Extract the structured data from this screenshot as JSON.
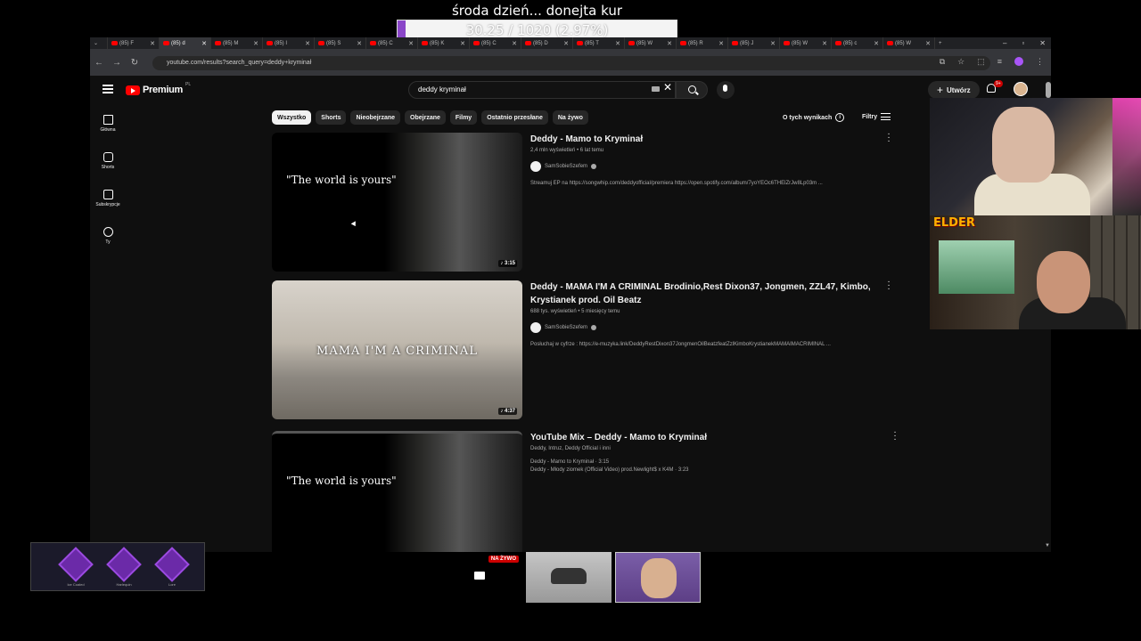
{
  "overlay": {
    "goal_title": "środa dzień... donejta kur",
    "goal_text": "30.25 / 1020 (2.97%)",
    "goal_progress": 0.0297,
    "goal_color": "#8a46c8"
  },
  "browser": {
    "tabs": [
      {
        "label": "(85) F",
        "active": false
      },
      {
        "label": "(85) d",
        "active": true
      },
      {
        "label": "(85) M",
        "active": false
      },
      {
        "label": "(85) I",
        "active": false
      },
      {
        "label": "(85) S",
        "active": false
      },
      {
        "label": "(85) C",
        "active": false
      },
      {
        "label": "(85) K",
        "active": false
      },
      {
        "label": "(85) C",
        "active": false
      },
      {
        "label": "(85) D",
        "active": false
      },
      {
        "label": "(85) T",
        "active": false
      },
      {
        "label": "(85) W",
        "active": false
      },
      {
        "label": "(85) R",
        "active": false
      },
      {
        "label": "(85) J",
        "active": false
      },
      {
        "label": "(85) W",
        "active": false
      },
      {
        "label": "(85) c",
        "active": false
      },
      {
        "label": "(85) W",
        "active": false
      }
    ],
    "new_tab": "+",
    "url": "youtube.com/results?search_query=deddy+kryminał"
  },
  "youtube": {
    "brand": "Premium",
    "brand_country": "PL",
    "search_value": "deddy kryminał",
    "create_label": "Utwórz",
    "notif_count": "9+",
    "sidebar": [
      {
        "label": "Główna",
        "icon": "home-icon"
      },
      {
        "label": "Shorts",
        "icon": "shorts-icon"
      },
      {
        "label": "Subskrypcje",
        "icon": "subscriptions-icon"
      },
      {
        "label": "Ty",
        "icon": "you-icon"
      }
    ],
    "chips": [
      "Wszystko",
      "Shorts",
      "Nieobejrzane",
      "Obejrzane",
      "Filmy",
      "Ostatnio przesłane",
      "Na żywo"
    ],
    "about_label": "O tych wynikach",
    "filters_label": "Filtry",
    "results": [
      {
        "title": "Deddy - Mamo to Kryminał",
        "meta": "2,4 mln wyświetleń • 6 lat temu",
        "channel": "SamSobieSzefem",
        "desc": "Streamuj EP na https://songwhip.com/deddyofficial/premiera https://open.spotify.com/album/7yoYEOc6THElZrJw8Lp03m ...",
        "duration": "3:15",
        "thumb_text": "\"The world is yours\""
      },
      {
        "title": "Deddy - MAMA I'M A CRIMINAL Brodinio,Rest Dixon37, Jongmen, ZZL47, Kimbo, Krystianek prod. Oil Beatz",
        "meta": "688 tys. wyświetleń • 5 miesięcy temu",
        "channel": "SamSobieSzefem",
        "desc": "Posłuchaj w cyfrze : https://e-muzyka.link/DeddyRestDixon37JongmenOilBeatzfeatZzlKimboKrystianekMAMAIMACRIMINAL ...",
        "duration": "4:37",
        "thumb_text": "MAMA I'M A CRIMINAL"
      },
      {
        "title": "YouTube Mix – Deddy - Mamo to Kryminał",
        "meta": "Deddy, Intruz, Deddy Official i inni",
        "line1": "Deddy - Mamo to Kryminał · 3:15",
        "line2": "Deddy - Młody ziomek (Official Video) prod.Newlight$ x K4M · 3:23",
        "thumb_text": "\"The world is yours\""
      }
    ]
  },
  "stream": {
    "cam_label": "ELDER",
    "live_badge": "NA ŻYWO",
    "cases": [
      "Ice Coaled",
      "Harlequin",
      "Lore"
    ]
  }
}
